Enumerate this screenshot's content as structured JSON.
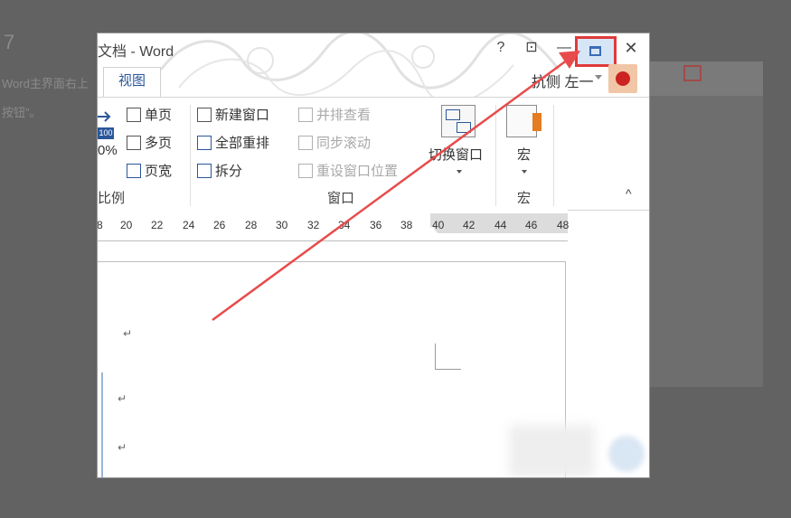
{
  "background": {
    "text_lines": [
      "7",
      "Word主界面右上",
      "按钮”。"
    ]
  },
  "window": {
    "title": "文档 - Word",
    "controls": {
      "help": "?",
      "ribbon_display": "⊡",
      "minimize": "—",
      "close": "✕"
    }
  },
  "tabs": {
    "active": "视图"
  },
  "account": {
    "user_name": "抗侧 左一"
  },
  "ribbon": {
    "zoom_fragment": "0%",
    "zoom_badge": "100",
    "views": [
      "单页",
      "多页",
      "页宽"
    ],
    "window_items": [
      "新建窗口",
      "全部重排",
      "拆分"
    ],
    "window_items_disabled": [
      "并排查看",
      "同步滚动",
      "重设窗口位置"
    ],
    "switch_window": "切换窗口",
    "macro": "宏",
    "groups": {
      "zoom": "比例",
      "window": "窗口",
      "macro": "宏"
    },
    "collapse": "^"
  },
  "ruler": {
    "ticks": [
      "8",
      "20",
      "22",
      "24",
      "26",
      "28",
      "30",
      "32",
      "34",
      "36",
      "38",
      "40",
      "42",
      "44",
      "46",
      "48"
    ]
  },
  "document": {
    "para_mark": "↵"
  },
  "colors": {
    "accent": "#2b579a",
    "highlight_border": "#e03a3a",
    "arrow": "#e84b4b"
  }
}
